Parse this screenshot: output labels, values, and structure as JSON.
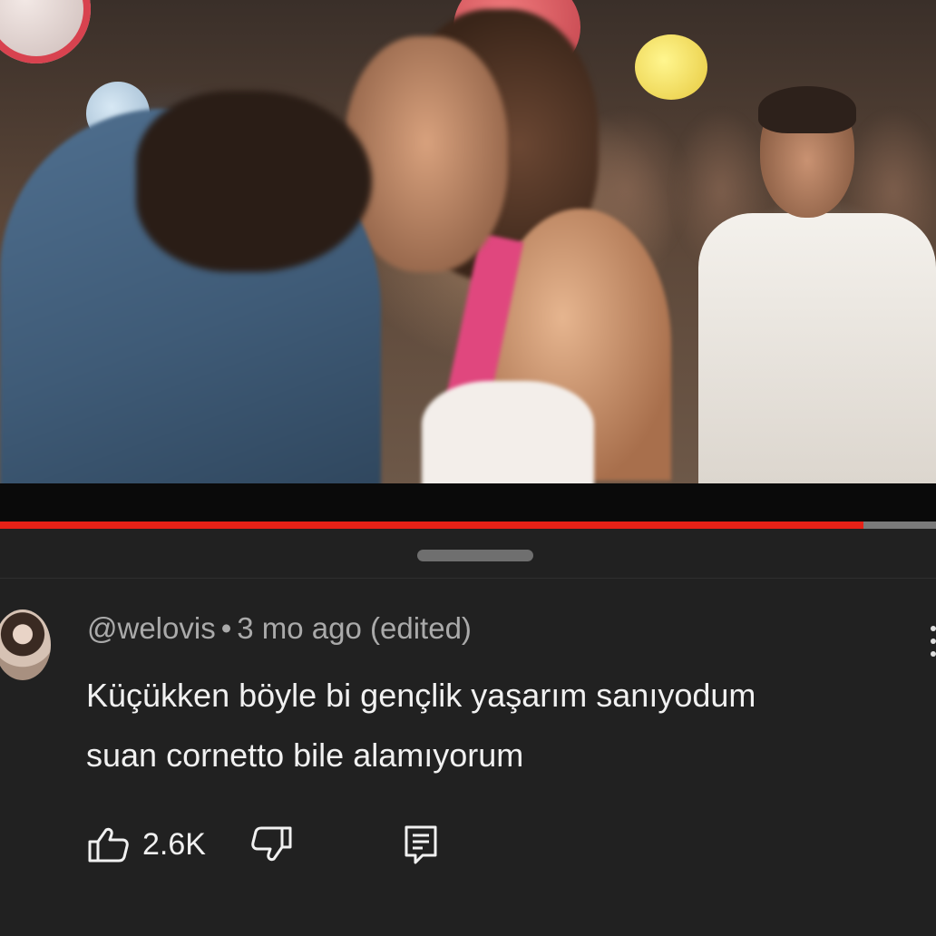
{
  "video": {
    "progress": 0.922
  },
  "comment": {
    "author": "@welovis",
    "separator": "•",
    "time": "3 mo ago (edited)",
    "text_line1": "Küçükken böyle bi gençlik yaşarım sanıyodum",
    "text_line2": "suan cornetto bile alamıyorum",
    "likes": "2.6K"
  },
  "colors": {
    "background": "#212121",
    "progress_played": "#e62117",
    "progress_track": "#7a7a7a",
    "meta_text": "#aaaaaa",
    "comment_text": "#f1f1f1"
  },
  "icons": [
    "thumbs-up-icon",
    "thumbs-down-icon",
    "reply-icon",
    "more-options-icon"
  ]
}
